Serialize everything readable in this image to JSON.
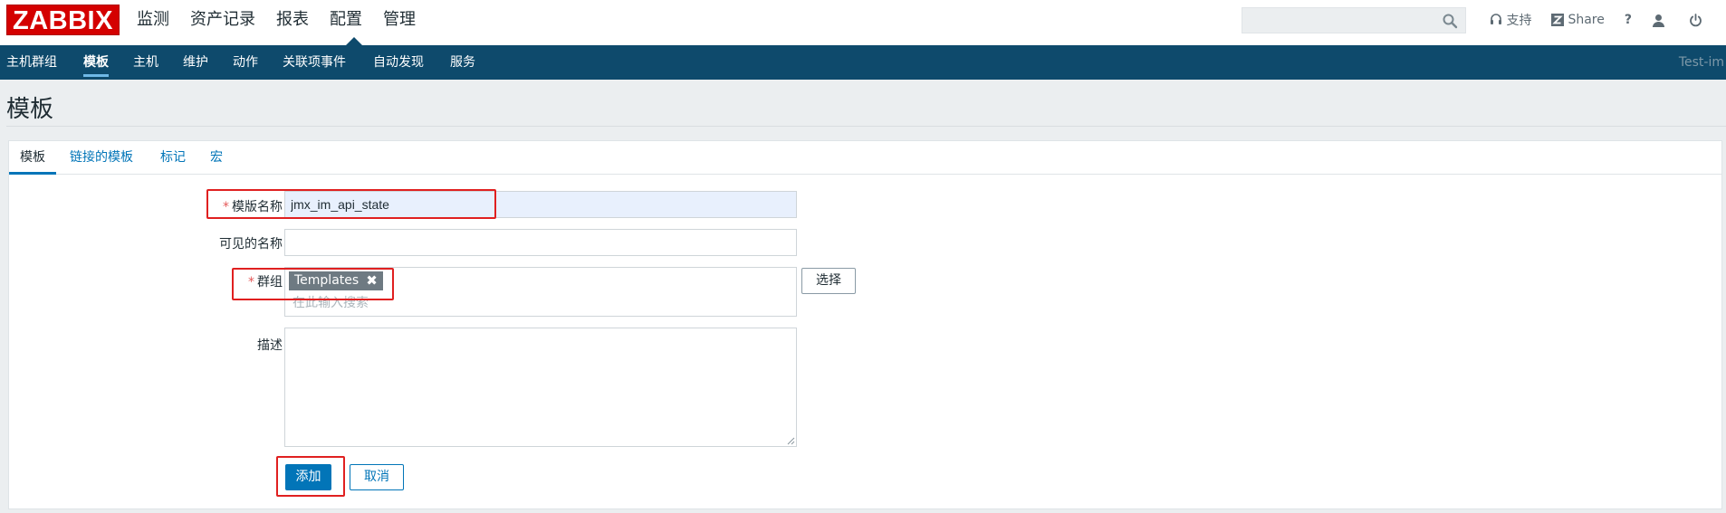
{
  "brand": {
    "logo": "ZABBIX",
    "logo_color": "#d40000"
  },
  "main_menu": [
    {
      "label": "监测"
    },
    {
      "label": "资产记录"
    },
    {
      "label": "报表"
    },
    {
      "label": "配置",
      "active": true
    },
    {
      "label": "管理"
    }
  ],
  "header": {
    "search_placeholder": "",
    "search_icon": "search-icon",
    "support_label": "支持",
    "share_label": "Share",
    "help_label": "?",
    "user_icon": "user-icon",
    "logout_icon": "power-icon"
  },
  "sub_nav": {
    "items": [
      {
        "label": "主机群组"
      },
      {
        "label": "模板",
        "active": true
      },
      {
        "label": "主机"
      },
      {
        "label": "维护"
      },
      {
        "label": "动作"
      },
      {
        "label": "关联项事件"
      },
      {
        "label": "自动发现"
      },
      {
        "label": "服务"
      }
    ],
    "server_name": "Test-im"
  },
  "page": {
    "title": "模板"
  },
  "tabs": [
    {
      "label": "模板",
      "active": true
    },
    {
      "label": "链接的模板"
    },
    {
      "label": "标记"
    },
    {
      "label": "宏"
    }
  ],
  "form": {
    "required_marker": "*",
    "template_name": {
      "label": "模版名称",
      "value": "jmx_im_api_state"
    },
    "visible_name": {
      "label": "可见的名称",
      "value": ""
    },
    "groups": {
      "label": "群组",
      "tags": [
        "Templates"
      ],
      "remove_glyph": "✖",
      "placeholder": "在此输入搜索",
      "select_button": "选择"
    },
    "description": {
      "label": "描述",
      "value": ""
    },
    "add_button": "添加",
    "cancel_button": "取消"
  },
  "colors": {
    "nav_bg": "#0e4a6c",
    "primary": "#0275b8",
    "highlight": "#e02020",
    "tag_bg": "#6e7a82"
  }
}
